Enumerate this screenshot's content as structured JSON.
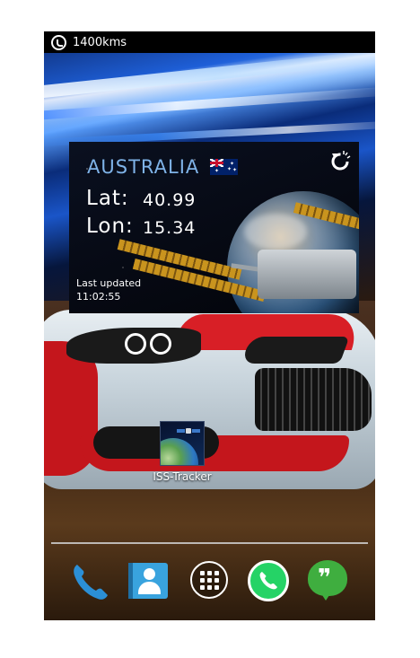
{
  "status_bar": {
    "icon": "whatsapp-notification-icon",
    "text": "1400kms"
  },
  "widget": {
    "country": "AUSTRALIA",
    "flag_icon": "australia-flag-icon",
    "refresh_icon": "refresh-icon",
    "lat_label": "Lat:",
    "lat_value": "40.99",
    "lon_label": "Lon:",
    "lon_value": "15.34",
    "updated_label": "Last updated",
    "updated_time": "11:02:55"
  },
  "desktop_app": {
    "label": "ISS-Tracker",
    "icon": "iss-tracker-icon"
  },
  "dock": [
    {
      "name": "phone",
      "icon": "phone-icon"
    },
    {
      "name": "contacts",
      "icon": "contacts-icon"
    },
    {
      "name": "app-drawer",
      "icon": "app-drawer-icon"
    },
    {
      "name": "whatsapp",
      "icon": "whatsapp-icon"
    },
    {
      "name": "hangouts",
      "icon": "hangouts-icon"
    }
  ],
  "colors": {
    "widget_country": "#7fb3e8",
    "whatsapp_green": "#25d366",
    "hangouts_green": "#3fae3f",
    "contacts_blue": "#39a3de",
    "phone_blue": "#2b8fd6"
  }
}
